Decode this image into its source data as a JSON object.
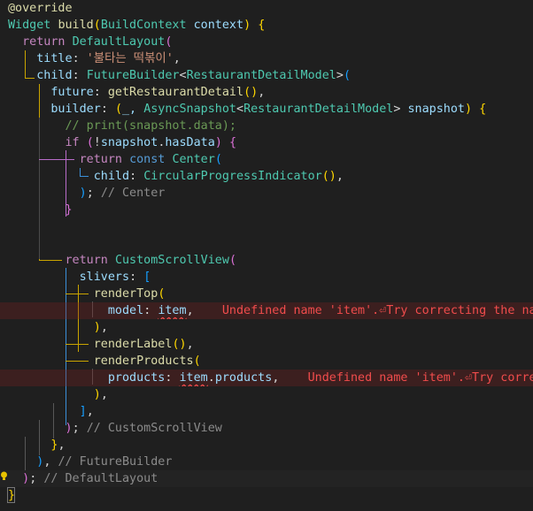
{
  "editor": {
    "theme": "dark",
    "colors": {
      "background": "#1f1f1f",
      "keyword": "#569cd6",
      "control": "#c586c0",
      "type": "#4ec9b0",
      "function": "#dcdcaa",
      "variable": "#9cdcfe",
      "string": "#ce9178",
      "comment": "#6a9955",
      "error": "#f14c4c"
    },
    "lines": [
      [
        [
          "@override",
          "t-fn"
        ]
      ],
      [
        [
          "Widget ",
          "t-type"
        ],
        [
          "build",
          "t-fn"
        ],
        [
          "(",
          "t-b1"
        ],
        [
          "BuildContext ",
          "t-type"
        ],
        [
          "context",
          "t-var"
        ],
        [
          "(",
          "t-none"
        ],
        [
          ") ",
          "t-b1"
        ],
        [
          "{",
          "t-b1"
        ]
      ],
      [
        [
          "  return ",
          "t-ctl"
        ],
        [
          "DefaultLayout",
          "t-type"
        ],
        [
          "(",
          "t-b2"
        ]
      ],
      [
        [
          "    title",
          "t-var"
        ],
        [
          ": ",
          "t-punc"
        ],
        [
          "'불타는 떡볶이'",
          "t-str"
        ],
        [
          ",",
          "t-punc"
        ]
      ],
      [
        [
          "    child",
          "t-var"
        ],
        [
          ": ",
          "t-punc"
        ],
        [
          "FutureBuilder",
          "t-type"
        ],
        [
          "<",
          "t-punc"
        ],
        [
          "RestaurantDetailModel",
          "t-type"
        ],
        [
          ">",
          "t-punc"
        ],
        [
          "(",
          "t-b3"
        ]
      ],
      [
        [
          "      future",
          "t-var"
        ],
        [
          ": ",
          "t-punc"
        ],
        [
          "getRestaurantDetail",
          "t-fn"
        ],
        [
          "(",
          "t-b1"
        ],
        [
          ")",
          "t-b1"
        ],
        [
          ",",
          "t-punc"
        ]
      ],
      [
        [
          "      builder",
          "t-var"
        ],
        [
          ": ",
          "t-punc"
        ],
        [
          "(",
          "t-b1"
        ],
        [
          "_, ",
          "t-var"
        ],
        [
          "AsyncSnapshot",
          "t-type"
        ],
        [
          "<",
          "t-punc"
        ],
        [
          "RestaurantDetailModel",
          "t-type"
        ],
        [
          "> ",
          "t-punc"
        ],
        [
          "snapshot",
          "t-var"
        ],
        [
          ") ",
          "t-b1"
        ],
        [
          "{",
          "t-b1"
        ]
      ],
      [
        [
          "        // print(snapshot.data);",
          "t-com"
        ]
      ],
      [
        [
          "        if ",
          "t-ctl"
        ],
        [
          "(",
          "t-b2"
        ],
        [
          "!",
          "t-punc"
        ],
        [
          "snapshot",
          "t-var"
        ],
        [
          ".",
          "t-punc"
        ],
        [
          "hasData",
          "t-var"
        ],
        [
          ") ",
          "t-b2"
        ],
        [
          "{",
          "t-b2"
        ]
      ],
      [
        [
          "          return ",
          "t-ctl"
        ],
        [
          "const ",
          "t-kw"
        ],
        [
          "Center",
          "t-type"
        ],
        [
          "(",
          "t-b3"
        ]
      ],
      [
        [
          "            child",
          "t-var"
        ],
        [
          ": ",
          "t-punc"
        ],
        [
          "CircularProgressIndicator",
          "t-type"
        ],
        [
          "(",
          "t-b1"
        ],
        [
          ")",
          "t-b1"
        ],
        [
          ",",
          "t-punc"
        ]
      ],
      [
        [
          "          )",
          "t-b3"
        ],
        [
          "; ",
          "t-punc"
        ],
        [
          "// Center",
          "t-cmt"
        ]
      ],
      [
        [
          "        }",
          "t-b2"
        ]
      ],
      [],
      [],
      [
        [
          "        return ",
          "t-ctl"
        ],
        [
          "CustomScrollView",
          "t-type"
        ],
        [
          "(",
          "t-b2"
        ]
      ],
      [
        [
          "          slivers",
          "t-var"
        ],
        [
          ": ",
          "t-punc"
        ],
        [
          "[",
          "t-b3"
        ]
      ],
      [
        [
          "            renderTop",
          "t-fn"
        ],
        [
          "(",
          "t-b1"
        ]
      ],
      [
        [
          "              model",
          "t-var"
        ],
        [
          ": ",
          "t-punc"
        ],
        [
          "item",
          "t-var t-und"
        ],
        [
          ",",
          "t-punc"
        ],
        [
          "    Undefined name 'item'.⏎Try correcting the name",
          "t-err"
        ]
      ],
      [
        [
          "            )",
          "t-b1"
        ],
        [
          ",",
          "t-punc"
        ]
      ],
      [
        [
          "            renderLabel",
          "t-fn"
        ],
        [
          "(",
          "t-b1"
        ],
        [
          ")",
          "t-b1"
        ],
        [
          ",",
          "t-punc"
        ]
      ],
      [
        [
          "            renderProducts",
          "t-fn"
        ],
        [
          "(",
          "t-b1"
        ]
      ],
      [
        [
          "              products",
          "t-var"
        ],
        [
          ": ",
          "t-punc"
        ],
        [
          "item",
          "t-var t-und"
        ],
        [
          ".",
          "t-punc"
        ],
        [
          "products",
          "t-var"
        ],
        [
          ",",
          "t-punc"
        ],
        [
          "    Undefined name 'item'.⏎Try correcti",
          "t-err"
        ]
      ],
      [
        [
          "            )",
          "t-b1"
        ],
        [
          ",",
          "t-punc"
        ]
      ],
      [
        [
          "          ]",
          "t-b3"
        ],
        [
          ",",
          "t-punc"
        ]
      ],
      [
        [
          "        )",
          "t-b2"
        ],
        [
          "; ",
          "t-punc"
        ],
        [
          "// CustomScrollView",
          "t-cmt"
        ]
      ],
      [
        [
          "      }",
          "t-b1"
        ],
        [
          ",",
          "t-punc"
        ]
      ],
      [
        [
          "    )",
          "t-b3"
        ],
        [
          ", ",
          "t-punc"
        ],
        [
          "// FutureBuilder",
          "t-cmt"
        ]
      ],
      [
        [
          "  )",
          "t-b2"
        ],
        [
          "; ",
          "t-punc"
        ],
        [
          "// DefaultLayout",
          "t-cmt"
        ]
      ],
      [
        [
          "}",
          "t-b1"
        ]
      ]
    ],
    "error_lines": [
      18,
      22
    ],
    "current_line": 28
  }
}
